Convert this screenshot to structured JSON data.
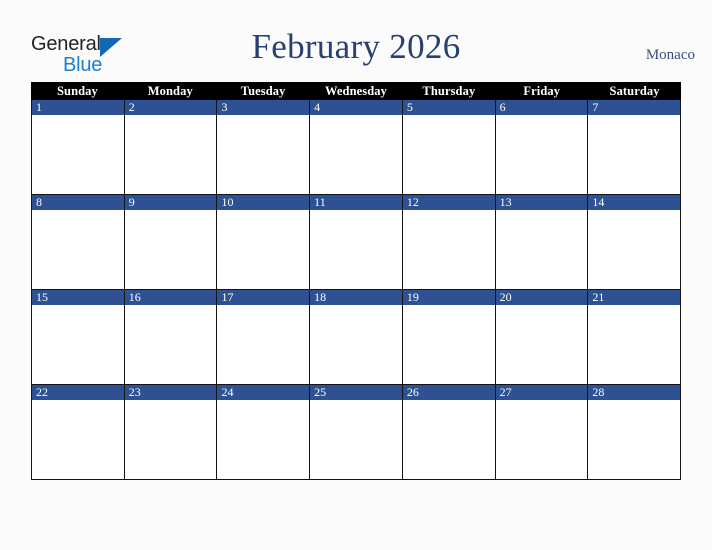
{
  "brand": {
    "name_part1": "General",
    "name_part2": "Blue",
    "triangle_icon": "triangle-icon",
    "colors": {
      "dark": "#222426",
      "blue": "#1d7fd0"
    }
  },
  "header": {
    "title": "February 2026",
    "country": "Monaco",
    "title_color": "#27406e",
    "country_color": "#3a4f7a"
  },
  "calendar": {
    "month": "February",
    "year": "2026",
    "accent_color": "#2d5192",
    "header_bg": "#000000",
    "border_color": "#141414",
    "day_headers": [
      "Sunday",
      "Monday",
      "Tuesday",
      "Wednesday",
      "Thursday",
      "Friday",
      "Saturday"
    ],
    "weeks": [
      {
        "days": [
          {
            "num": "1",
            "events": ""
          },
          {
            "num": "2",
            "events": ""
          },
          {
            "num": "3",
            "events": ""
          },
          {
            "num": "4",
            "events": ""
          },
          {
            "num": "5",
            "events": ""
          },
          {
            "num": "6",
            "events": ""
          },
          {
            "num": "7",
            "events": ""
          }
        ]
      },
      {
        "days": [
          {
            "num": "8",
            "events": ""
          },
          {
            "num": "9",
            "events": ""
          },
          {
            "num": "10",
            "events": ""
          },
          {
            "num": "11",
            "events": ""
          },
          {
            "num": "12",
            "events": ""
          },
          {
            "num": "13",
            "events": ""
          },
          {
            "num": "14",
            "events": ""
          }
        ]
      },
      {
        "days": [
          {
            "num": "15",
            "events": ""
          },
          {
            "num": "16",
            "events": ""
          },
          {
            "num": "17",
            "events": ""
          },
          {
            "num": "18",
            "events": ""
          },
          {
            "num": "19",
            "events": ""
          },
          {
            "num": "20",
            "events": ""
          },
          {
            "num": "21",
            "events": ""
          }
        ]
      },
      {
        "days": [
          {
            "num": "22",
            "events": ""
          },
          {
            "num": "23",
            "events": ""
          },
          {
            "num": "24",
            "events": ""
          },
          {
            "num": "25",
            "events": ""
          },
          {
            "num": "26",
            "events": ""
          },
          {
            "num": "27",
            "events": ""
          },
          {
            "num": "28",
            "events": ""
          }
        ]
      }
    ]
  }
}
